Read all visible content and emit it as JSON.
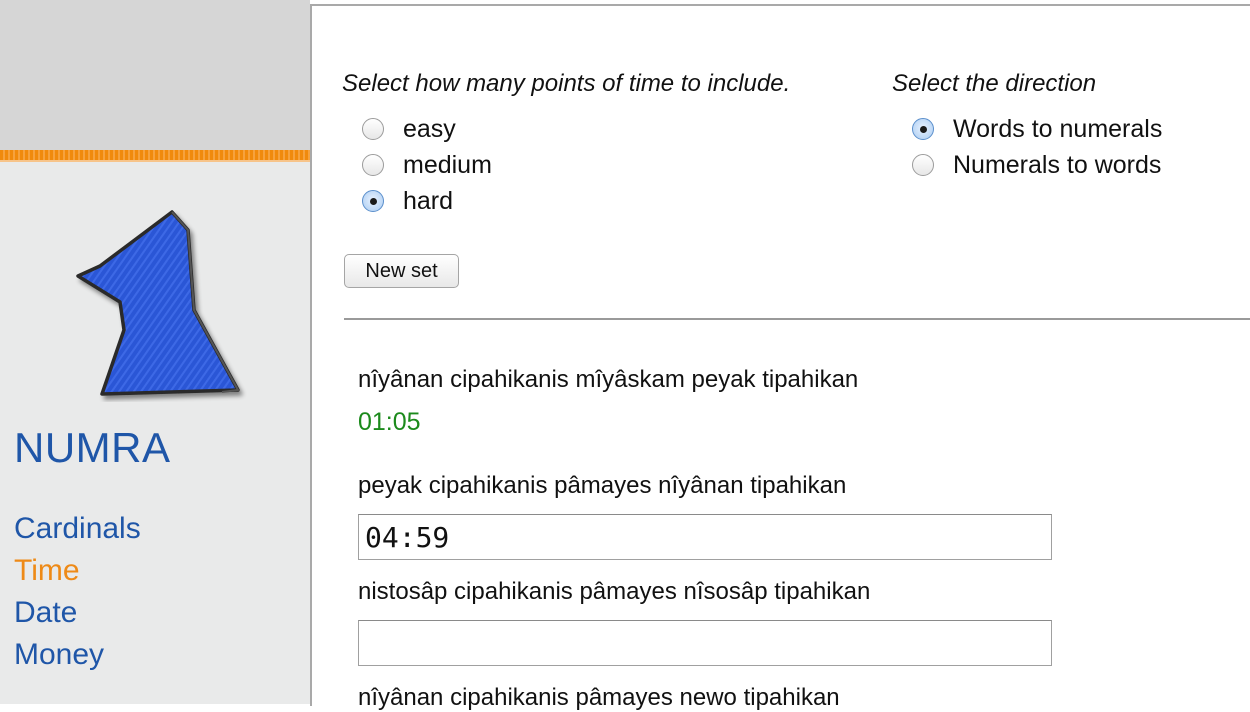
{
  "app": {
    "brand": "NUMRA",
    "nav": [
      "Cardinals",
      "Time",
      "Date",
      "Money"
    ],
    "active_nav": "Time"
  },
  "settings": {
    "points_prompt": "Select how many points of time to include.",
    "difficulty_options": [
      "easy",
      "medium",
      "hard"
    ],
    "difficulty_selected": "hard",
    "direction_prompt": "Select the direction",
    "direction_options": [
      "Words to numerals",
      "Numerals to words"
    ],
    "direction_selected": "Words to numerals",
    "new_set_label": "New set"
  },
  "questions": [
    {
      "text": "nîyânan cipahikanis mîyâskam peyak tipahikan",
      "answer": "01:05"
    },
    {
      "text": "peyak cipahikanis pâmayes nîyânan tipahikan",
      "input_value": "04:59"
    },
    {
      "text": "nistosâp cipahikanis pâmayes nîsosâp tipahikan",
      "input_value": ""
    },
    {
      "text": "nîyânan cipahikanis pâmayes newo tipahikan"
    }
  ],
  "colors": {
    "link": "#1f56a8",
    "active_link": "#ee8a17",
    "correct": "#1c8a1c",
    "accent_bar": "#f08a0c",
    "logo_fill": "#2a55d8"
  },
  "icons": {
    "logo": "blue-numeral-one-logo"
  }
}
